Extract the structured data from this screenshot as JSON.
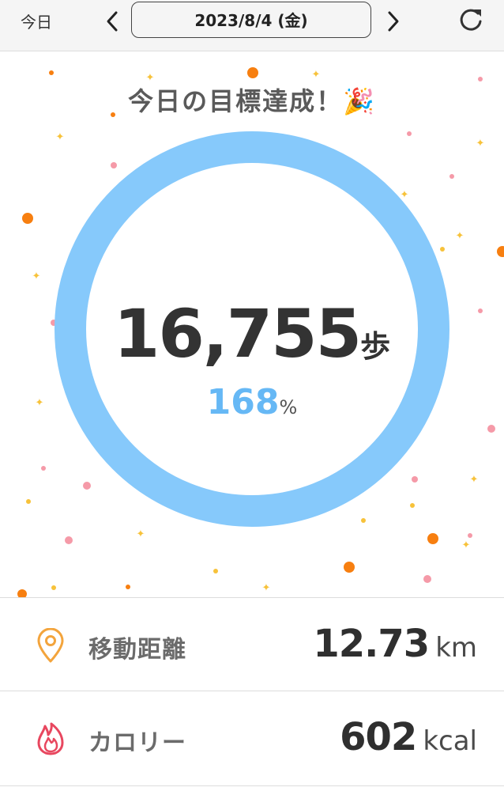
{
  "header": {
    "today_label": "今日",
    "date": "2023/8/4 (金)",
    "prev_icon": "chevron-left-icon",
    "next_icon": "chevron-right-icon",
    "refresh_icon": "refresh-icon"
  },
  "hero": {
    "title": "今日の目標達成！🎉",
    "steps": "16,755",
    "steps_unit": "歩",
    "percent": "168",
    "percent_unit": "%",
    "ring_color": "#86c9fb",
    "progress_fraction": 1.0
  },
  "stats": [
    {
      "icon": "location-pin-icon",
      "icon_color": "#f3a43c",
      "label": "移動距離",
      "value": "12.73",
      "unit": "km"
    },
    {
      "icon": "flame-icon",
      "icon_color": "#e8475f",
      "label": "カロリー",
      "value": "602",
      "unit": "kcal"
    }
  ],
  "colors": {
    "confetti_orange": "#f77f10",
    "confetti_pink": "#f59aa8",
    "confetti_yellow": "#f7c23a"
  }
}
